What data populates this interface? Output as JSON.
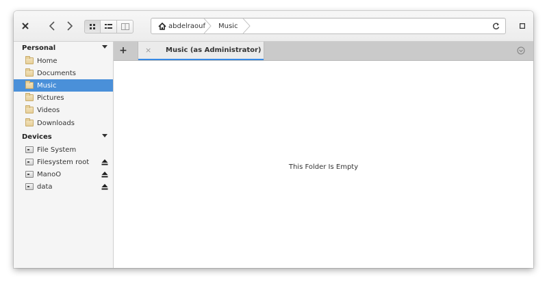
{
  "window": {
    "title": "Music (as Administrator)"
  },
  "headerbar": {
    "close_icon": "close-icon",
    "back_icon": "chevron-left-icon",
    "forward_icon": "chevron-right-icon",
    "view_modes": [
      "grid-view-icon",
      "list-view-icon",
      "column-view-icon"
    ],
    "breadcrumbs": [
      {
        "label": "abdelraouf",
        "icon": "home-icon"
      },
      {
        "label": "Music"
      }
    ],
    "reload_icon": "reload-icon",
    "menu_icon": "window-menu-icon"
  },
  "sidebar": {
    "personal_header": "Personal",
    "personal_items": [
      {
        "label": "Home",
        "icon": "home-folder-icon"
      },
      {
        "label": "Documents",
        "icon": "folder-icon"
      },
      {
        "label": "Music",
        "icon": "folder-icon",
        "selected": true
      },
      {
        "label": "Pictures",
        "icon": "folder-icon"
      },
      {
        "label": "Videos",
        "icon": "folder-icon"
      },
      {
        "label": "Downloads",
        "icon": "folder-icon"
      }
    ],
    "devices_header": "Devices",
    "device_items": [
      {
        "label": "File System",
        "icon": "drive-icon",
        "ejectable": false
      },
      {
        "label": "Filesystem root",
        "icon": "drive-icon",
        "ejectable": true
      },
      {
        "label": "ManoO",
        "icon": "drive-icon",
        "ejectable": true
      },
      {
        "label": "data",
        "icon": "drive-icon",
        "ejectable": true
      }
    ]
  },
  "tabs": {
    "new_tab_label": "+",
    "items": [
      {
        "label": "Music (as Administrator)",
        "active": true
      }
    ],
    "tab_close_label": "×"
  },
  "content": {
    "empty_message": "This Folder Is Empty"
  },
  "colors": {
    "accent": "#3689e6",
    "selection": "#4a90d9"
  }
}
